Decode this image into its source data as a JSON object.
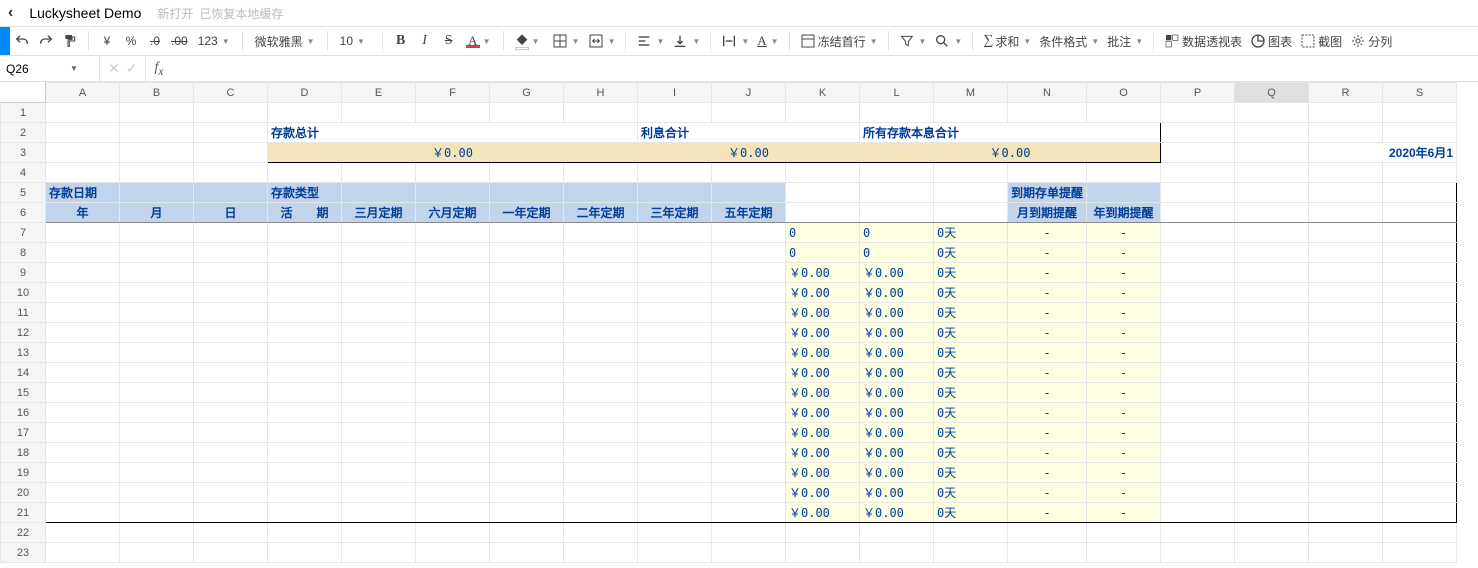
{
  "topbar": {
    "title": "Luckysheet Demo",
    "newOpen": "新打开",
    "restored": "已恢复本地缓存"
  },
  "toolbar": {
    "currency": "¥",
    "percent": "%",
    "decDec": ".0",
    "incDec": ".00",
    "numFmt": "123",
    "fontName": "微软雅黑",
    "fontSize": "10",
    "freeze": "冻结首行",
    "sum": "求和",
    "condFmt": "条件格式",
    "comment": "批注",
    "pivot": "数据透视表",
    "chart": "图表",
    "screenshot": "截图",
    "split": "分列"
  },
  "formula": {
    "cellRef": "Q26"
  },
  "columns": [
    "A",
    "B",
    "C",
    "D",
    "E",
    "F",
    "G",
    "H",
    "I",
    "J",
    "K",
    "L",
    "M",
    "N",
    "O",
    "P",
    "Q",
    "R",
    "S"
  ],
  "rowCount": 23,
  "summary": {
    "depositTotalLabel": "存款总计",
    "depositTotalValue": "￥0.00",
    "interestTotalLabel": "利息合计",
    "interestTotalValue": "￥0.00",
    "allTotalLabel": "所有存款本息合计",
    "allTotalValue": "￥0.00",
    "dateRight": "2020年6月1"
  },
  "groupHeaders": {
    "depositDate": "存款日期",
    "depositType": "存款类型",
    "reminder": "到期存单提醒"
  },
  "subHeaders": {
    "year": "年",
    "month": "月",
    "day": "日",
    "current": "活　　期",
    "m3": "三月定期",
    "m6": "六月定期",
    "y1": "一年定期",
    "y2": "二年定期",
    "y3": "三年定期",
    "y5": "五年定期",
    "remMonth": "月到期提醒",
    "remYear": "年到期提醒"
  },
  "dataRows": [
    {
      "k": "0",
      "l": "0",
      "m": "0天",
      "n": "-",
      "o": "-"
    },
    {
      "k": "0",
      "l": "0",
      "m": "0天",
      "n": "-",
      "o": "-"
    },
    {
      "k": "￥0.00",
      "l": "￥0.00",
      "m": "0天",
      "n": "-",
      "o": "-"
    },
    {
      "k": "￥0.00",
      "l": "￥0.00",
      "m": "0天",
      "n": "-",
      "o": "-"
    },
    {
      "k": "￥0.00",
      "l": "￥0.00",
      "m": "0天",
      "n": "-",
      "o": "-"
    },
    {
      "k": "￥0.00",
      "l": "￥0.00",
      "m": "0天",
      "n": "-",
      "o": "-"
    },
    {
      "k": "￥0.00",
      "l": "￥0.00",
      "m": "0天",
      "n": "-",
      "o": "-"
    },
    {
      "k": "￥0.00",
      "l": "￥0.00",
      "m": "0天",
      "n": "-",
      "o": "-"
    },
    {
      "k": "￥0.00",
      "l": "￥0.00",
      "m": "0天",
      "n": "-",
      "o": "-"
    },
    {
      "k": "￥0.00",
      "l": "￥0.00",
      "m": "0天",
      "n": "-",
      "o": "-"
    },
    {
      "k": "￥0.00",
      "l": "￥0.00",
      "m": "0天",
      "n": "-",
      "o": "-"
    },
    {
      "k": "￥0.00",
      "l": "￥0.00",
      "m": "0天",
      "n": "-",
      "o": "-"
    },
    {
      "k": "￥0.00",
      "l": "￥0.00",
      "m": "0天",
      "n": "-",
      "o": "-"
    },
    {
      "k": "￥0.00",
      "l": "￥0.00",
      "m": "0天",
      "n": "-",
      "o": "-"
    },
    {
      "k": "￥0.00",
      "l": "￥0.00",
      "m": "0天",
      "n": "-",
      "o": "-"
    }
  ]
}
